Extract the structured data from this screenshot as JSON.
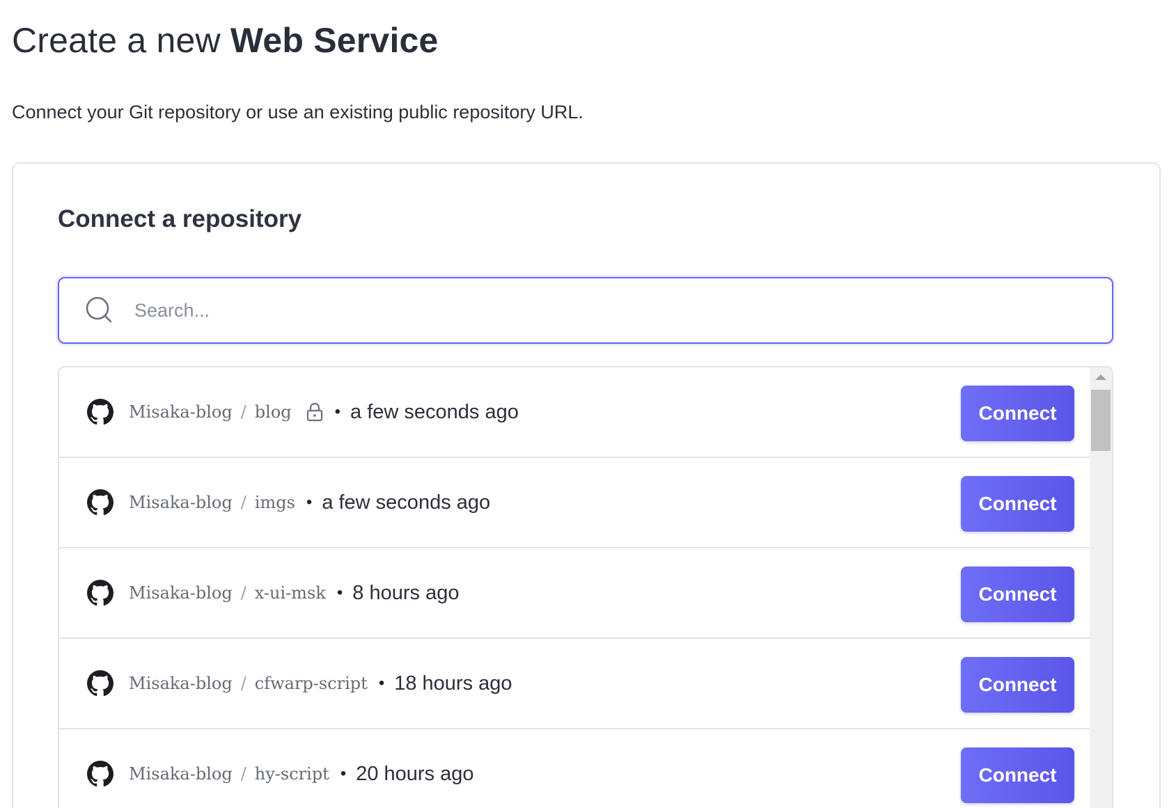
{
  "header": {
    "title_prefix": "Create a new ",
    "title_strong": "Web Service",
    "subtitle": "Connect your Git repository or use an existing public repository URL."
  },
  "card": {
    "title": "Connect a repository",
    "search": {
      "placeholder": "Search...",
      "value": ""
    },
    "repos": [
      {
        "owner": "Misaka-blog",
        "separator": "/",
        "name": "blog",
        "private": true,
        "dot": "•",
        "updated": "a few seconds ago",
        "action": "Connect"
      },
      {
        "owner": "Misaka-blog",
        "separator": "/",
        "name": "imgs",
        "private": false,
        "dot": "•",
        "updated": "a few seconds ago",
        "action": "Connect"
      },
      {
        "owner": "Misaka-blog",
        "separator": "/",
        "name": "x-ui-msk",
        "private": false,
        "dot": "•",
        "updated": "8 hours ago",
        "action": "Connect"
      },
      {
        "owner": "Misaka-blog",
        "separator": "/",
        "name": "cfwarp-script",
        "private": false,
        "dot": "•",
        "updated": "18 hours ago",
        "action": "Connect"
      },
      {
        "owner": "Misaka-blog",
        "separator": "/",
        "name": "hy-script",
        "private": false,
        "dot": "•",
        "updated": "20 hours ago",
        "action": "Connect"
      }
    ]
  },
  "icons": {
    "search": "search-icon",
    "repo_provider": "github-icon",
    "private": "lock-icon"
  },
  "colors": {
    "accent": "#6366f1",
    "button": "#5b56e8",
    "border": "#dfe3ee"
  }
}
